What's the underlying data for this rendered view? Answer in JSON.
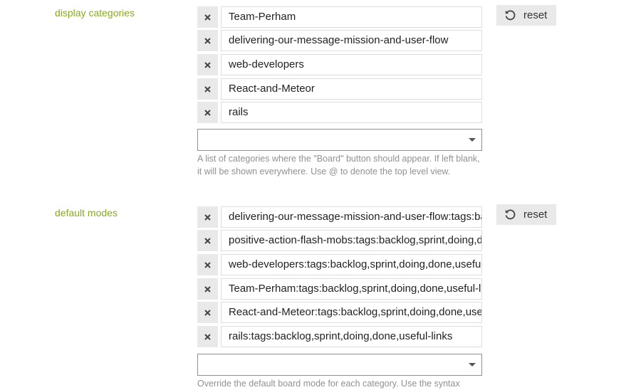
{
  "settings": [
    {
      "label": "display categories",
      "values": [
        "Team-Perham",
        "delivering-our-message-mission-and-user-flow",
        "web-developers",
        "React-and-Meteor",
        "rails"
      ],
      "select_value": "",
      "description": "A list of categories where the \"Board\" button should appear. If left blank, it will be shown everywhere. Use @ to denote the top level view.",
      "reset_label": "reset"
    },
    {
      "label": "default modes",
      "values": [
        "delivering-our-message-mission-and-user-flow:tags:backlog,sprint,doing,done,useful-links",
        "positive-action-flash-mobs:tags:backlog,sprint,doing,done,useful-links",
        "web-developers:tags:backlog,sprint,doing,done,useful-links",
        "Team-Perham:tags:backlog,sprint,doing,done,useful-links",
        "React-and-Meteor:tags:backlog,sprint,doing,done,useful-links",
        "rails:tags:backlog,sprint,doing,done,useful-links"
      ],
      "select_value": "",
      "description": "Override the default board mode for each category. Use the syntax",
      "reset_label": "reset"
    }
  ],
  "icons": {
    "remove": "close-icon",
    "reset": "undo-icon",
    "dropdown": "chevron-down-icon"
  },
  "colors": {
    "label": "#88aa21",
    "button_bg": "#e9e9e9",
    "description": "#919191"
  }
}
